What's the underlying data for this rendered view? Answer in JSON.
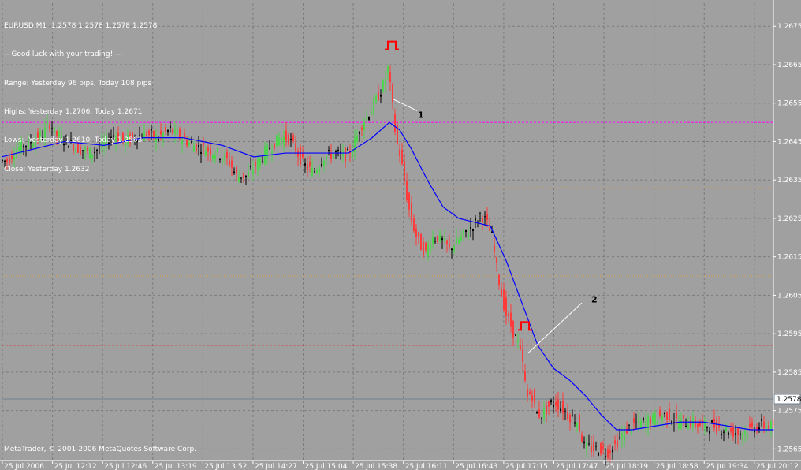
{
  "header": {
    "symbol_line": "EURUSD,M1  1.2578 1.2578 1.2578 1.2578",
    "info_lines": [
      "-- Good luck with your trading! ---",
      "Range: Yesterday 96 pips, Today 108 pips",
      "Highs: Yesterday 1.2706, Today 1.2671",
      "Lows:  Yesterday 1.2610, Today 1.2563",
      "Close: Yesterday 1.2632"
    ]
  },
  "footer": {
    "copyright": "MetaTrader, © 2001-2006 MetaQuotes Software Corp."
  },
  "colors": {
    "background": "#a0a0a0",
    "grid": "#7b7b7b",
    "axis": "#ffffff",
    "bull": "#4ed44e",
    "bear": "#ff3b3b",
    "neutral": "#000000",
    "moving_average": "#0000ff",
    "pivot_line": "#ff00ff",
    "yesterday_levels": "#e0a040",
    "signal_line": "#ff0000",
    "current_price_line": "#708090",
    "annotation": "#ffffff",
    "marker": "#ff0000"
  },
  "chart_data": {
    "type": "candlestick",
    "symbol": "EURUSD",
    "timeframe": "M1",
    "ylim": [
      1.2562,
      1.2681
    ],
    "y_ticks": [
      "1.2675",
      "1.2665",
      "1.2655",
      "1.2645",
      "1.2635",
      "1.2625",
      "1.2615",
      "1.2605",
      "1.2595",
      "1.2585",
      "1.2575",
      "1.2565"
    ],
    "x_ticks": [
      "25 Jul 2006",
      "25 Jul 12:12",
      "25 Jul 12:46",
      "25 Jul 13:19",
      "25 Jul 13:52",
      "25 Jul 14:27",
      "25 Jul 15:04",
      "25 Jul 15:38",
      "25 Jul 16:11",
      "25 Jul 16:43",
      "25 Jul 17:15",
      "25 Jul 17:47",
      "25 Jul 18:19",
      "25 Jul 18:58",
      "25 Jul 19:34",
      "25 Jul 20:12"
    ],
    "current_price": "1.2578",
    "horizontal_levels": [
      {
        "price": 1.265,
        "style": "dashed",
        "color_key": "pivot_line"
      },
      {
        "price": 1.2633,
        "style": "dotted",
        "color_key": "yesterday_levels"
      },
      {
        "price": 1.261,
        "style": "dotted",
        "color_key": "yesterday_levels"
      },
      {
        "price": 1.2592,
        "style": "dashed",
        "color_key": "signal_line"
      }
    ],
    "price_path": [
      [
        0,
        1.264
      ],
      [
        10,
        1.264
      ],
      [
        20,
        1.2643
      ],
      [
        30,
        1.2644
      ],
      [
        40,
        1.2645
      ],
      [
        55,
        1.2647
      ],
      [
        62,
        1.265
      ],
      [
        70,
        1.2647
      ],
      [
        85,
        1.2645
      ],
      [
        100,
        1.2643
      ],
      [
        115,
        1.2642
      ],
      [
        130,
        1.2644
      ],
      [
        145,
        1.2647
      ],
      [
        155,
        1.2645
      ],
      [
        170,
        1.2646
      ],
      [
        185,
        1.2647
      ],
      [
        200,
        1.2646
      ],
      [
        215,
        1.2648
      ],
      [
        230,
        1.2646
      ],
      [
        245,
        1.2644
      ],
      [
        260,
        1.2643
      ],
      [
        275,
        1.2642
      ],
      [
        290,
        1.264
      ],
      [
        300,
        1.2636
      ],
      [
        312,
        1.2636
      ],
      [
        325,
        1.2639
      ],
      [
        340,
        1.2643
      ],
      [
        355,
        1.2646
      ],
      [
        365,
        1.2646
      ],
      [
        375,
        1.2643
      ],
      [
        385,
        1.2639
      ],
      [
        398,
        1.2637
      ],
      [
        410,
        1.2641
      ],
      [
        425,
        1.2642
      ],
      [
        440,
        1.2641
      ],
      [
        450,
        1.2645
      ],
      [
        460,
        1.265
      ],
      [
        470,
        1.2653
      ],
      [
        480,
        1.2657
      ],
      [
        487,
        1.266
      ],
      [
        492,
        1.2664
      ],
      [
        497,
        1.2656
      ],
      [
        502,
        1.2646
      ],
      [
        508,
        1.2641
      ],
      [
        515,
        1.2632
      ],
      [
        520,
        1.2626
      ],
      [
        527,
        1.2621
      ],
      [
        533,
        1.2618
      ],
      [
        540,
        1.2616
      ],
      [
        547,
        1.262
      ],
      [
        555,
        1.262
      ],
      [
        562,
        1.2619
      ],
      [
        570,
        1.2617
      ],
      [
        580,
        1.2619
      ],
      [
        590,
        1.2621
      ],
      [
        600,
        1.2623
      ],
      [
        610,
        1.2626
      ],
      [
        617,
        1.2624
      ],
      [
        624,
        1.262
      ],
      [
        630,
        1.2612
      ],
      [
        636,
        1.2605
      ],
      [
        642,
        1.26
      ],
      [
        650,
        1.2596
      ],
      [
        658,
        1.2592
      ],
      [
        664,
        1.2586
      ],
      [
        668,
        1.2578
      ],
      [
        674,
        1.258
      ],
      [
        680,
        1.2574
      ],
      [
        688,
        1.2574
      ],
      [
        695,
        1.2576
      ],
      [
        705,
        1.2577
      ],
      [
        715,
        1.2575
      ],
      [
        725,
        1.2573
      ],
      [
        733,
        1.2572
      ],
      [
        740,
        1.2566
      ],
      [
        750,
        1.2565
      ],
      [
        760,
        1.2565
      ],
      [
        770,
        1.2564
      ],
      [
        780,
        1.2566
      ],
      [
        790,
        1.2569
      ],
      [
        800,
        1.2571
      ],
      [
        815,
        1.2572
      ],
      [
        830,
        1.2573
      ],
      [
        845,
        1.2574
      ],
      [
        860,
        1.2572
      ],
      [
        875,
        1.2572
      ],
      [
        890,
        1.2571
      ],
      [
        905,
        1.2571
      ],
      [
        920,
        1.257
      ],
      [
        935,
        1.2569
      ],
      [
        950,
        1.257
      ],
      [
        965,
        1.2571
      ],
      [
        980,
        1.2571
      ]
    ],
    "moving_average": [
      [
        0,
        1.2641
      ],
      [
        40,
        1.2643
      ],
      [
        80,
        1.2645
      ],
      [
        130,
        1.2644
      ],
      [
        180,
        1.2646
      ],
      [
        230,
        1.2646
      ],
      [
        280,
        1.2644
      ],
      [
        320,
        1.2641
      ],
      [
        360,
        1.2642
      ],
      [
        400,
        1.2642
      ],
      [
        440,
        1.2642
      ],
      [
        470,
        1.2646
      ],
      [
        492,
        1.265
      ],
      [
        505,
        1.2648
      ],
      [
        520,
        1.2643
      ],
      [
        540,
        1.2635
      ],
      [
        560,
        1.2628
      ],
      [
        580,
        1.2625
      ],
      [
        600,
        1.2624
      ],
      [
        620,
        1.2623
      ],
      [
        640,
        1.2614
      ],
      [
        660,
        1.2603
      ],
      [
        680,
        1.2592
      ],
      [
        700,
        1.2586
      ],
      [
        720,
        1.2583
      ],
      [
        740,
        1.2579
      ],
      [
        760,
        1.2574
      ],
      [
        780,
        1.257
      ],
      [
        800,
        1.257
      ],
      [
        830,
        1.2571
      ],
      [
        860,
        1.2572
      ],
      [
        890,
        1.2572
      ],
      [
        920,
        1.2571
      ],
      [
        950,
        1.257
      ],
      [
        980,
        1.257
      ]
    ],
    "annotations": [
      {
        "label": "1",
        "price": 1.2652
      },
      {
        "label": "2",
        "price": 1.2604
      }
    ],
    "signal_markers": [
      {
        "symbol": "⎍",
        "price": 1.267
      },
      {
        "symbol": "⎍",
        "price": 1.2597
      }
    ]
  }
}
